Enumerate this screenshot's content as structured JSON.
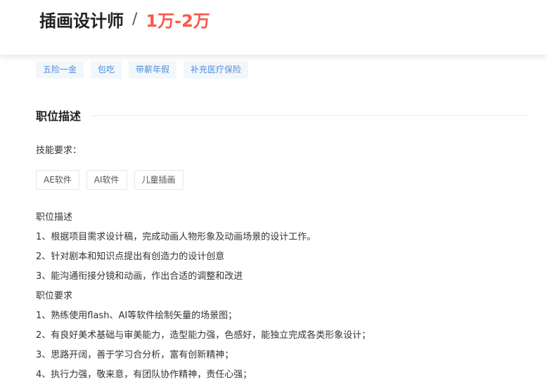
{
  "header": {
    "job_title": "插画设计师",
    "separator": "/",
    "salary": "1万-2万"
  },
  "benefits": [
    "五险一金",
    "包吃",
    "带薪年假",
    "补充医疗保险"
  ],
  "section": {
    "title": "职位描述"
  },
  "skills": {
    "label": "技能要求：",
    "tags": [
      "AE软件",
      "AI软件",
      "儿童插画"
    ]
  },
  "description": [
    "职位描述",
    "1、根据项目需求设计稿，完成动画人物形象及动画场景的设计工作。",
    "2、针对剧本和知识点提出有创造力的设计创意",
    "3、能沟通衔接分镜和动画，作出合适的调整和改进",
    "职位要求",
    "1、熟练使用flash、AI等软件绘制矢量的场景图；",
    "2、有良好美术基础与审美能力，造型能力强，色感好，能独立完成各类形象设计；",
    "3、思路开阔，善于学习合分析，富有创新精神；",
    "4、执行力强，敬来意，有团队协作精神，责任心强；"
  ],
  "colors": {
    "salary": "#fe574a",
    "benefit_text": "#4f8fd6",
    "benefit_bg": "#f2f7fc"
  }
}
